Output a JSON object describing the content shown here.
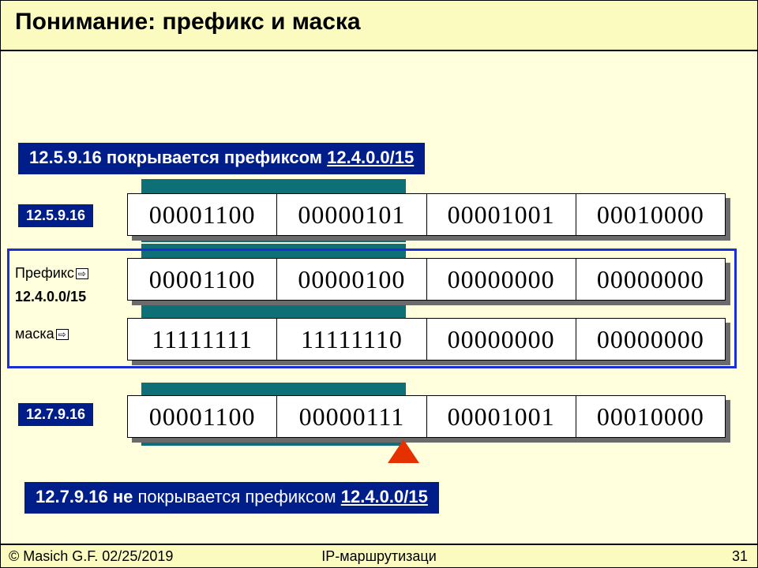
{
  "title": "Понимание: префикс и маска",
  "banner_top": {
    "pre": "12.5.9.16 покрывается префиксом ",
    "under": "12.4.0.0/15"
  },
  "banner_bot": {
    "pre": "12.7.9.16 не ",
    "mid": "покрывается префиксом ",
    "under": "12.4.0.0/15"
  },
  "labels": {
    "ip1": "12.5.9.16",
    "ip2": "12.7.9.16",
    "prefix_word": "Префикс",
    "cidr": "12.4.0.0/15",
    "mask_word": "маска"
  },
  "rows": {
    "addr1": [
      "00001100",
      "00000101",
      "00001001",
      "00010000"
    ],
    "prefix": [
      "00001100",
      "00000100",
      "00000000",
      "00000000"
    ],
    "mask": [
      "11111111",
      "11111110",
      "00000000",
      "00000000"
    ],
    "addr2": [
      "00001100",
      "00000111",
      "00001001",
      "00010000"
    ]
  },
  "footer": {
    "left": "© Masich G.F. 02/25/2019",
    "center": "IP-маршрутизаци",
    "right": "31"
  }
}
